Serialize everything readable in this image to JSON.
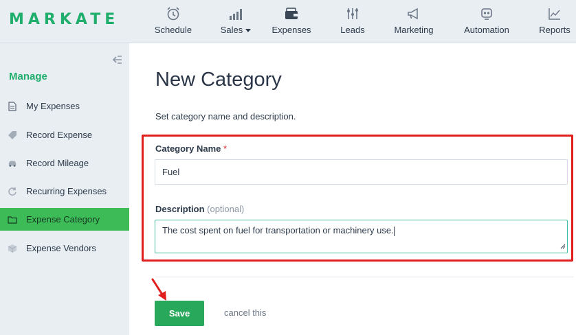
{
  "brand": {
    "logo": "MARKATE",
    "accent": "#1fae6b"
  },
  "topnav": {
    "items": [
      {
        "label": "Schedule",
        "icon": "alarm-clock-icon"
      },
      {
        "label": "Sales",
        "icon": "bar-chart-icon",
        "has_dropdown": true
      },
      {
        "label": "Expenses",
        "icon": "wallet-icon"
      },
      {
        "label": "Leads",
        "icon": "sliders-icon"
      },
      {
        "label": "Marketing",
        "icon": "megaphone-icon"
      },
      {
        "label": "Automation",
        "icon": "robot-icon"
      },
      {
        "label": "Reports",
        "icon": "line-chart-icon"
      }
    ]
  },
  "sidebar": {
    "heading": "Manage",
    "items": [
      {
        "label": "My Expenses",
        "icon": "document-icon",
        "active": false
      },
      {
        "label": "Record Expense",
        "icon": "tag-icon",
        "active": false
      },
      {
        "label": "Record Mileage",
        "icon": "car-icon",
        "active": false
      },
      {
        "label": "Recurring Expenses",
        "icon": "refresh-icon",
        "active": false
      },
      {
        "label": "Expense Category",
        "icon": "folder-icon",
        "active": true
      },
      {
        "label": "Expense Vendors",
        "icon": "box-icon",
        "active": false
      }
    ],
    "active_color": "#3cbb57"
  },
  "page": {
    "title": "New Category",
    "subtitle": "Set category name and description."
  },
  "form": {
    "name_label": "Category Name",
    "name_required_mark": "*",
    "name_value": "Fuel",
    "description_label": "Description",
    "description_hint": "(optional)",
    "description_value": "The cost spent on fuel for transportation or machinery use."
  },
  "actions": {
    "save_label": "Save",
    "cancel_label": "cancel this"
  },
  "annotation_color": "#e01e1e"
}
